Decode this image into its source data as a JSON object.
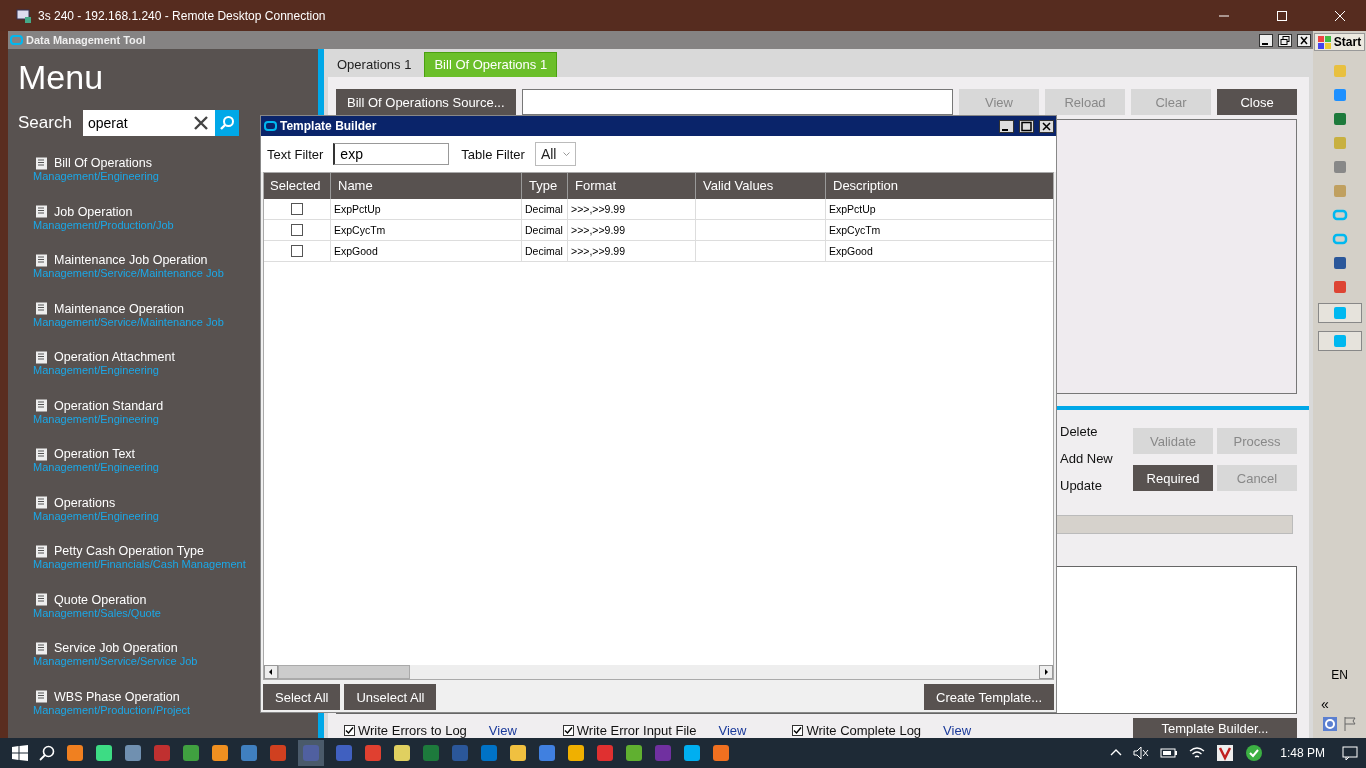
{
  "remote_window": {
    "title": "3s 240 - 192.168.1.240 - Remote Desktop Connection"
  },
  "app": {
    "title": "Data Management Tool"
  },
  "menu": {
    "title": "Menu",
    "search_label": "Search",
    "search_value": "operat",
    "items": [
      {
        "name": "Bill Of Operations",
        "path": "Management/Engineering"
      },
      {
        "name": "Job Operation",
        "path": "Management/Production/Job"
      },
      {
        "name": "Maintenance Job Operation",
        "path": "Management/Service/Maintenance Job"
      },
      {
        "name": "Maintenance Operation",
        "path": "Management/Service/Maintenance Job"
      },
      {
        "name": "Operation Attachment",
        "path": "Management/Engineering"
      },
      {
        "name": "Operation Standard",
        "path": "Management/Engineering"
      },
      {
        "name": "Operation Text",
        "path": "Management/Engineering"
      },
      {
        "name": "Operations",
        "path": "Management/Engineering"
      },
      {
        "name": "Petty Cash Operation Type",
        "path": "Management/Financials/Cash Management"
      },
      {
        "name": "Quote Operation",
        "path": "Management/Sales/Quote"
      },
      {
        "name": "Service Job Operation",
        "path": "Management/Service/Service Job"
      },
      {
        "name": "WBS Phase Operation",
        "path": "Management/Production/Project"
      }
    ]
  },
  "tabs": [
    {
      "label": "Operations 1",
      "selected": false
    },
    {
      "label": "Bill Of Operations 1",
      "selected": true
    }
  ],
  "toolbar": {
    "source_button": "Bill Of Operations Source...",
    "buttons": [
      {
        "label": "View",
        "kind": "light"
      },
      {
        "label": "Reload",
        "kind": "light"
      },
      {
        "label": "Clear",
        "kind": "light"
      },
      {
        "label": "Close",
        "kind": "dark"
      }
    ]
  },
  "actions": {
    "labels": [
      "Delete",
      "Add New",
      "Update"
    ],
    "buttons": [
      {
        "label": "Validate",
        "kind": "light"
      },
      {
        "label": "Process",
        "kind": "light"
      },
      {
        "label": "Required",
        "kind": "dark"
      },
      {
        "label": "Cancel",
        "kind": "light"
      }
    ]
  },
  "options": [
    {
      "label": "Write Errors to Log",
      "checked": true,
      "link": "View"
    },
    {
      "label": "Write Error Input File",
      "checked": true,
      "link": "View"
    },
    {
      "label": "Write Complete Log",
      "checked": true,
      "link": "View"
    }
  ],
  "template_builder_button": "Template Builder...",
  "dialog": {
    "title": "Template Builder",
    "text_filter_label": "Text Filter",
    "text_filter_value": "exp",
    "table_filter_label": "Table Filter",
    "table_filter_value": "All",
    "columns": [
      "Selected",
      "Name",
      "Type",
      "Format",
      "Valid Values",
      "Description"
    ],
    "rows": [
      {
        "selected": false,
        "name": "ExpPctUp",
        "type": "Decimal",
        "format": ">>>,>>9.99",
        "description": "ExpPctUp"
      },
      {
        "selected": false,
        "name": "ExpCycTm",
        "type": "Decimal",
        "format": ">>>,>>9.99",
        "description": "ExpCycTm"
      },
      {
        "selected": false,
        "name": "ExpGood",
        "type": "Decimal",
        "format": ">>>,>>9.99",
        "description": "ExpGood"
      }
    ],
    "buttons": [
      "Select All",
      "Unselect All"
    ],
    "create_button": "Create Template..."
  },
  "side_strip": {
    "start": "Start",
    "language": "EN",
    "expand": "«"
  },
  "taskbar": {
    "time": "1:48 PM"
  }
}
